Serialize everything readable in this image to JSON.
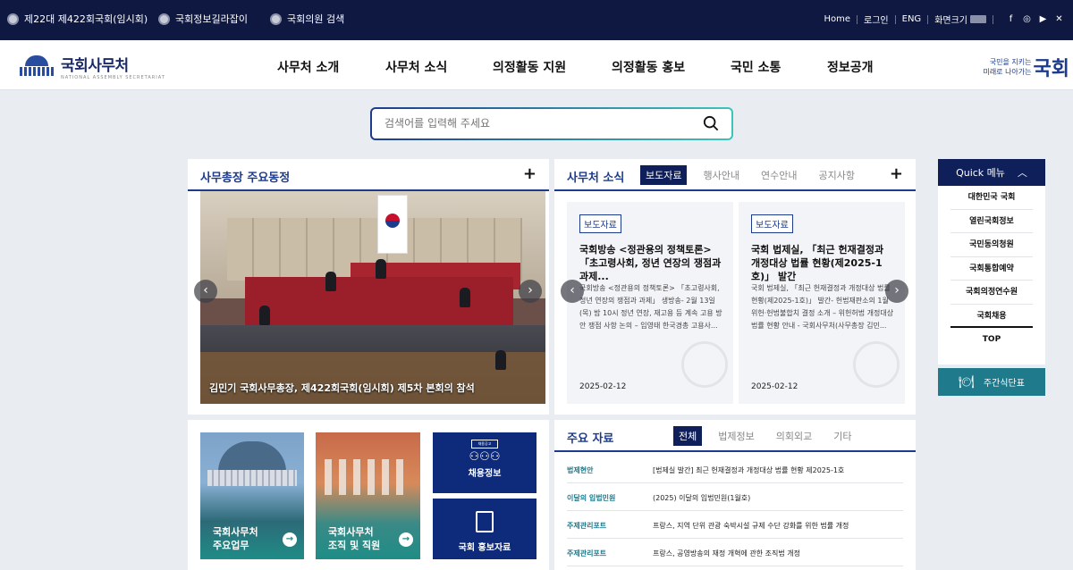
{
  "topbar": {
    "left": [
      "제22대 제422회국회(임시회)",
      "국회정보길라잡이",
      "국회의원 검색"
    ],
    "right": [
      "Home",
      "로그인",
      "ENG",
      "화면크기"
    ]
  },
  "header": {
    "logo": "국회사무처",
    "logo_sub": "NATIONAL ASSEMBLY SECRETARIAT",
    "nav": [
      "사무처 소개",
      "사무처 소식",
      "의정활동 지원",
      "의정활동 홍보",
      "국민 소통",
      "정보공개"
    ],
    "slogan_line1": "국민을 지키는",
    "slogan_line2": "미래로 나아가는",
    "slogan_big": "국회"
  },
  "search": {
    "placeholder": "검색어를 입력해 주세요"
  },
  "secgen": {
    "title": "사무총장 주요동정",
    "caption": "김민기 국회사무총장, 제422회국회(임시회) 제5차 본회의 참석"
  },
  "news": {
    "title": "사무처 소식",
    "tabs": [
      "보도자료",
      "행사안내",
      "연수안내",
      "공지사항"
    ],
    "cards": [
      {
        "badge": "보도자료",
        "title": "국회방송 <정관용의 정책토론> 「초고령사회, 정년 연장의 쟁점과 과제...",
        "body": "국회방송 <정관용의 정책토론> 「초고령사회, 정년 연장의 쟁점과 과제」 생방송- 2월 13일(목) 밤 10시 정년 연장, 재고용 등 계속 고용 방안 쟁점 사항 논의 – 임영태 한국경총 고용사...",
        "date": "2025-02-12"
      },
      {
        "badge": "보도자료",
        "title": "국회 법제실, 「최근 헌재결정과 개정대상 법률 현황(제2025-1호)」 발간",
        "body": "국회 법제실, 「최근 헌재결정과 개정대상 법률 현황(제2025-1호)」 발간- 헌법재판소의 1월 위헌·헌법불합치 결정 소개 – 위헌허법 개정대상 법률 현황 안내 - 국회사무처(사무총장 김민...",
        "date": "2025-02-12"
      }
    ]
  },
  "quick": {
    "title": "Quick 메뉴",
    "items": [
      "대한민국 국회",
      "열린국회정보",
      "국민동의청원",
      "국회통합예약",
      "국회의정연수원",
      "국회채용"
    ],
    "top": "TOP",
    "menu": "주간식단표"
  },
  "tiles": {
    "t1": [
      "국회사무처",
      "주요업무"
    ],
    "t2": [
      "국회사무처",
      "조직 및 직원"
    ],
    "jobs": "채용정보",
    "jobs_badge": "채용공고",
    "pr": "국회 홍보자료"
  },
  "materials": {
    "title": "주요 자료",
    "tabs": [
      "전체",
      "법제정보",
      "의회외교",
      "기타"
    ],
    "rows": [
      {
        "cat": "법제현안",
        "title": "[법제실 발간] 최근 헌재결정과 개정대상 법률 현황 제2025-1호"
      },
      {
        "cat": "이달의 입법민원",
        "title": "(2025) 이달의 입법민원(1월호)"
      },
      {
        "cat": "주제관리포트",
        "title": "프랑스, 지역 단위 관광 숙박시설 규제 수단 강화를 위한 법률 개정"
      },
      {
        "cat": "주제관리포트",
        "title": "프랑스, 공영방송의 재정 개혁에 관한 조직법 개정"
      }
    ]
  }
}
